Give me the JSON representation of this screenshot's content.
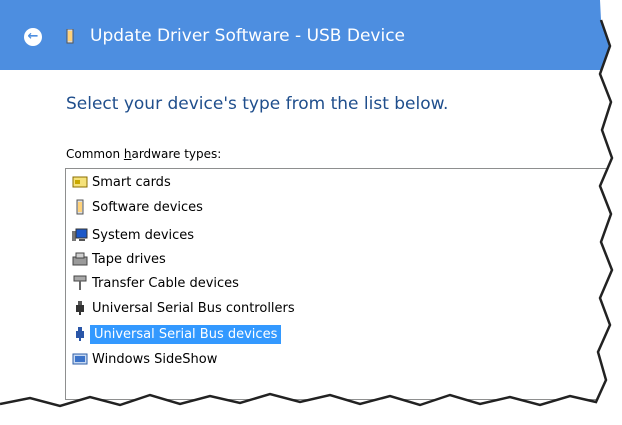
{
  "window": {
    "title": "Update Driver Software - USB Device"
  },
  "heading": "Select your device's type from the list below.",
  "list_label": {
    "before": "Common ",
    "access_key": "h",
    "after": "ardware types:"
  },
  "hardware_types": [
    {
      "label": "Smart cards",
      "icon": "smart-card-icon",
      "selected": false
    },
    {
      "label": "Software devices",
      "icon": "usb-device-icon",
      "selected": false
    },
    {
      "label": "System devices",
      "icon": "system-devices-icon",
      "selected": false
    },
    {
      "label": "Tape drives",
      "icon": "tape-drive-icon",
      "selected": false
    },
    {
      "label": "Transfer Cable devices",
      "icon": "transfer-cable-icon",
      "selected": false
    },
    {
      "label": "Universal Serial Bus controllers",
      "icon": "usb-controller-icon",
      "selected": false
    },
    {
      "label": "Universal Serial Bus devices",
      "icon": "usb-controller-icon",
      "selected": true
    },
    {
      "label": "Windows SideShow",
      "icon": "sideshow-icon",
      "selected": false
    }
  ],
  "colors": {
    "titlebar": "#4d8ee0",
    "heading": "#1f4e8c",
    "selection": "#3399ff"
  }
}
